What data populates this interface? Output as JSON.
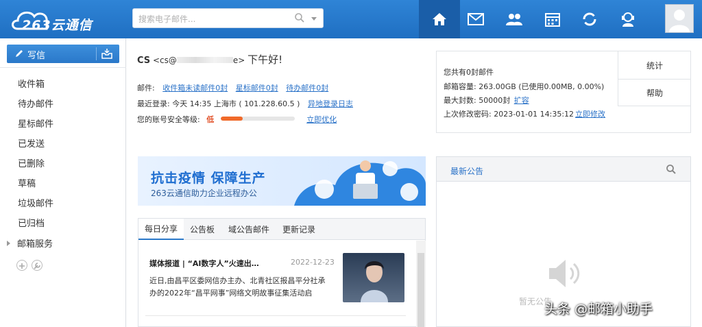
{
  "header": {
    "logo_text": "263云通信",
    "search_placeholder": "搜索电子邮件...",
    "nav_icons": [
      "home-icon",
      "mail-icon",
      "contacts-icon",
      "calendar-icon",
      "sync-icon",
      "support-icon"
    ]
  },
  "sidebar": {
    "compose_label": "写信",
    "folders": [
      "收件箱",
      "待办邮件",
      "星标邮件",
      "已发送",
      "已删除",
      "草稿",
      "垃圾邮件",
      "已归档"
    ],
    "mail_services": "邮箱服务"
  },
  "greeting": {
    "name": "CS",
    "email": "<cs@",
    "email_tail": "e>",
    "hello": "下午好!"
  },
  "mail_line": {
    "label": "邮件:",
    "unread": "收件箱未读邮件0封",
    "starred": "星标邮件0封",
    "todo": "待办邮件0封"
  },
  "login_line": {
    "label": "最近登录: 今天 14:35 上海市 ( 101.228.60.5 )",
    "link": "异地登录日志"
  },
  "security_line": {
    "label": "您的账号安全等级:",
    "level": "低",
    "level_percent": 30,
    "link": "立即优化"
  },
  "stats": {
    "total": "您共有0封邮件",
    "capacity": "邮箱容量: 263.00GB (已使用0.00MB, 0.00%)",
    "max_label": "最大封数: 50000封",
    "expand": "扩容",
    "pwd_label": "上次修改密码: 2023-01-01 14:35:12",
    "pwd_link": "立即修改",
    "btn_stats": "统计",
    "btn_help": "帮助"
  },
  "banner": {
    "title": "抗击疫情  保障生产",
    "subtitle": "263云通信助力企业远程办公"
  },
  "tabs": [
    "每日分享",
    "公告板",
    "域公告邮件",
    "更新记录"
  ],
  "news": {
    "title": "媒体报道 | “AI数字人”火速出…",
    "date": "2022-12-23",
    "body": "近日,由昌平区委网信办主办、北青社区报昌平分社承办的2022年“昌平网事”网络文明故事征集活动启"
  },
  "notice": {
    "title": "最新公告",
    "empty": "暂无公告"
  },
  "watermark": "头条 @邮箱小助手"
}
